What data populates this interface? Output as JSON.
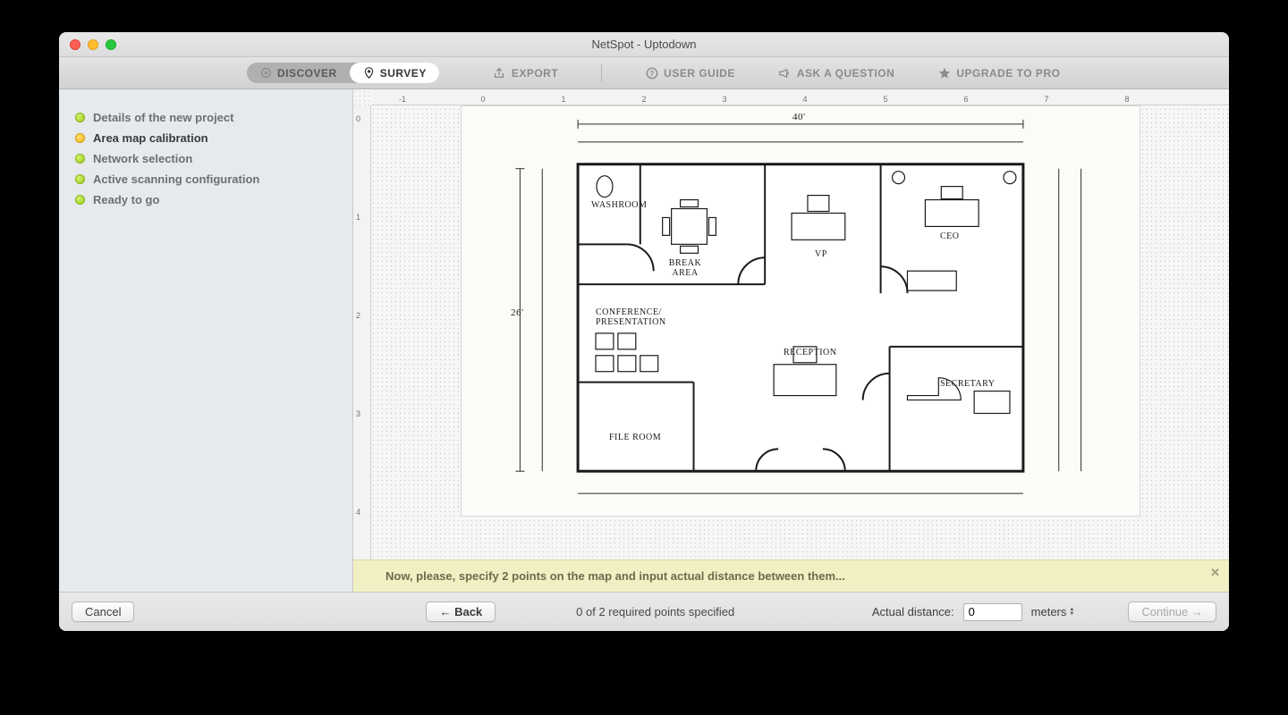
{
  "window": {
    "title": "NetSpot - Uptodown"
  },
  "toolbar": {
    "discover": "DISCOVER",
    "survey": "SURVEY",
    "export": "EXPORT",
    "user_guide": "USER GUIDE",
    "ask": "ASK A QUESTION",
    "upgrade": "UPGRADE TO PRO"
  },
  "sidebar": {
    "steps": [
      {
        "label": "Details of the new project",
        "active": false
      },
      {
        "label": "Area map calibration",
        "active": true
      },
      {
        "label": "Network selection",
        "active": false
      },
      {
        "label": "Active scanning configuration",
        "active": false
      },
      {
        "label": "Ready to go",
        "active": false
      }
    ]
  },
  "ruler": {
    "h_ticks": [
      "-1",
      "0",
      "1",
      "2",
      "3",
      "4",
      "5",
      "6",
      "7",
      "8"
    ],
    "h_positions": [
      35,
      125,
      215,
      305,
      395,
      485,
      575,
      665,
      755,
      845
    ],
    "v_ticks": [
      "0",
      "1",
      "2",
      "3",
      "4"
    ],
    "v_positions": [
      15,
      125,
      235,
      345,
      455
    ]
  },
  "floorplan": {
    "labels": {
      "washroom": "Washroom",
      "break": "Break Area",
      "vp": "VP",
      "ceo": "CEO",
      "conference": "Conference/ Presentation",
      "reception": "Reception",
      "secretary": "Secretary",
      "file": "File Room"
    },
    "width_label": "40'",
    "height_label": "26'"
  },
  "hint": {
    "text": "Now, please, specify 2 points on the map and input actual distance between them..."
  },
  "footer": {
    "cancel": "Cancel",
    "back": "← Back",
    "status": "0 of 2 required points specified",
    "distance_label": "Actual distance:",
    "distance_value": "0",
    "unit": "meters",
    "continue": "Continue →"
  }
}
